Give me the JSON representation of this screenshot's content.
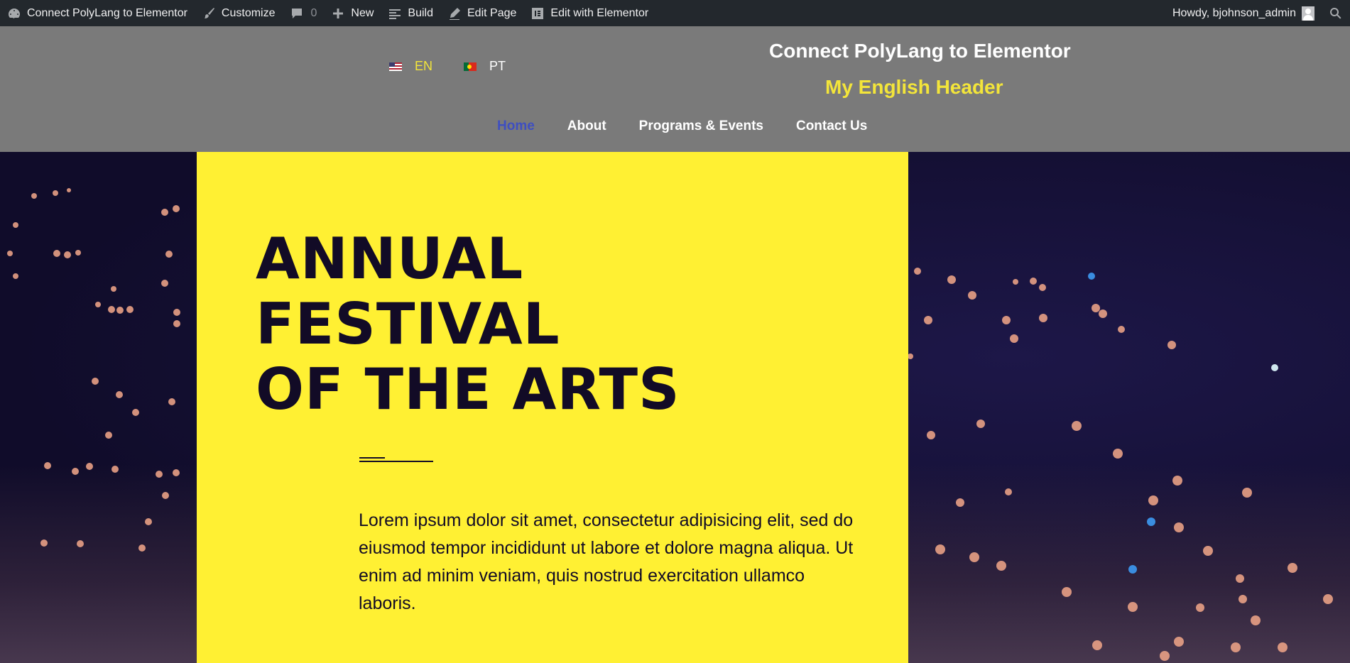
{
  "adminbar": {
    "site_name": "Connect PolyLang to Elementor",
    "customize": "Customize",
    "comments_count": "0",
    "new": "New",
    "build": "Build",
    "edit_page": "Edit Page",
    "edit_elementor": "Edit with Elementor",
    "howdy": "Howdy, bjohnson_admin"
  },
  "header": {
    "languages": [
      {
        "code": "EN",
        "color": "#f3e53a",
        "flag": "us-flag-icon"
      },
      {
        "code": "PT",
        "color": "#ffffff",
        "flag": "portugal-flag-icon"
      }
    ],
    "site_title": "Connect PolyLang to Elementor",
    "subtitle": "My English Header",
    "nav": [
      {
        "label": "Home",
        "color": "#3f4fc0"
      },
      {
        "label": "About",
        "color": "#ffffff"
      },
      {
        "label": "Programs & Events",
        "color": "#ffffff"
      },
      {
        "label": "Contact Us",
        "color": "#ffffff"
      }
    ]
  },
  "hero": {
    "title_lines": [
      "ANNUAL",
      "FESTIVAL",
      "OF THE ARTS"
    ],
    "body": "Lorem ipsum dolor sit amet, consectetur adipisicing elit, sed do eiusmod tempor incididunt ut labore et dolore magna aliqua. Ut enim ad minim veniam, quis nostrud exercitation ullamco laboris.",
    "panel_color": "#fff033",
    "text_color": "#120b26"
  }
}
